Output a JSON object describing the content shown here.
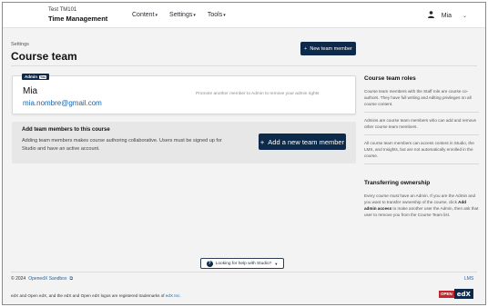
{
  "header": {
    "course_org": "Test TM101",
    "course_title": "Time Management",
    "nav": [
      {
        "label": "Content"
      },
      {
        "label": "Settings"
      },
      {
        "label": "Tools"
      }
    ],
    "username": "Mia"
  },
  "page": {
    "breadcrumb": "Settings",
    "title": "Course team",
    "new_member_label": "New team member"
  },
  "member": {
    "badge": "Admin",
    "badge_you": "You",
    "name": "Mia",
    "email": "mia.nombre@gmail.com",
    "hint": "Promote another member to Admin to remove your admin rights"
  },
  "add_box": {
    "title": "Add team members to this course",
    "description": "Adding team members makes course authoring collaborative. Users must be signed up for Studio and have an active account.",
    "button_label": "Add a new team member"
  },
  "sidebar": {
    "roles_heading": "Course team roles",
    "roles_p1": "Course team members with the Staff role are course co-authors. They have full writing and editing privileges on all course content.",
    "roles_p2": "Admins are course team members who can add and remove other course team members.",
    "roles_p3": "All course team members can access content in Studio, the LMS, and Insights, but are not automatically enrolled in the course.",
    "transfer_heading": "Transferring ownership",
    "transfer_pre": "Every course must have an Admin. If you are the Admin and you want to transfer ownership of the course, click ",
    "transfer_bold": "Add admin access",
    "transfer_post": " to make another user the Admin, then ask that user to remove you from the Course Team list."
  },
  "help": {
    "label": "Looking for help with Studio?"
  },
  "footer": {
    "copyright": "© 2024",
    "sandbox_link": "OpenedX Sandbox",
    "lms_link": "LMS",
    "trademark_text": "edX and Open edX, and the edX and Open edX logos are registered trademarks of ",
    "trademark_link": "edX Inc.",
    "logo_open": "OPEN",
    "logo_edx": "edX"
  },
  "icons": {
    "user": "user-icon",
    "plus": "plus-icon",
    "chevron": "chevron-down-icon",
    "help": "question-icon",
    "external": "external-link-icon"
  },
  "colors": {
    "primary": "#0e2a4a",
    "link": "#1b63a5",
    "logo_red": "#c2272d"
  }
}
